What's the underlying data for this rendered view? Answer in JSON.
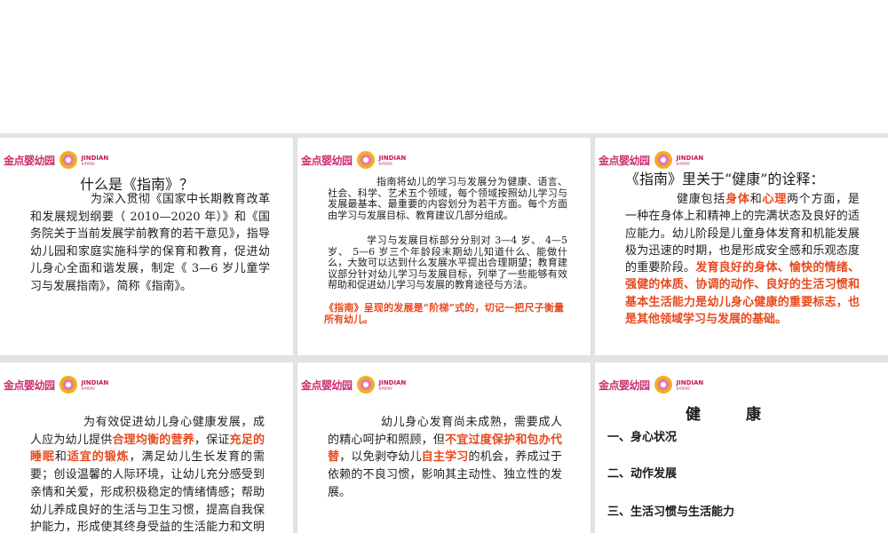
{
  "logo": {
    "text": "金点婴幼园",
    "brand": "JINDIAN",
    "brand_sub": "金点婴幼园",
    "icon": "jindian-emblem-icon",
    "colors": {
      "text": "#cc2f6f",
      "ring": "#f0b21c",
      "inner": "#e77aa8"
    }
  },
  "slides": [
    {
      "title": "什么是《指南》？",
      "paragraph": "为深入贯彻《国家中长期教育改革和发展规划纲要（ 2010—2020 年）》和《国务院关于当前发展学前教育的若干意见》，指导幼儿园和家庭实施科学的保育和教育，促进幼儿身心全面和谐发展，制定《 3—6 岁儿童学习与发展指南》，简称《指南》。"
    },
    {
      "para1": "指南将幼儿的学习与发展分为健康、语言、社会、科学、艺术五个领域，每个领域按照幼儿学习与发展最基本、最重要的内容划分为若干方面。每个方面由学习与发展目标、教育建议几部分组成。",
      "para2": "学习与发展目标部分分别对 3—4 岁、 4—5 岁、 5—6 岁三个年龄段末期幼儿知道什么、能做什么，大致可以达到什么发展水平提出合理期望；教育建议部分针对幼儿学习与发展目标，列举了一些能够有效帮助和促进幼儿学习与发展的教育途径与方法。",
      "note": "《指南》呈现的发展是“阶梯”式的，切记一把尺子衡量所有幼儿。"
    },
    {
      "title": "《指南》里关于“健康”的诠释：",
      "p1_a": "健康包括",
      "p1_hl1": "身体",
      "p1_b": "和",
      "p1_hl2": "心理",
      "p1_c": "两个方面，是一种在身体上和精神上的完满状态及良好的适应能力。幼儿阶段是儿童身体发育和机能发展极为迅速的时期，也是形成安全感和乐观态度的重要阶段。",
      "p1_hl3": "发育良好的身体、愉快的情绪、强健的体质、协调的动作、良好的生活习惯和基本生活能力是幼儿身心健康的重要标志，也是其他领域学习与发展的基础。"
    },
    {
      "p_a": "为有效促进幼儿身心健康发展，成人应为幼儿提供",
      "p_hl1": "合理均衡的营养",
      "p_b": "，保证",
      "p_hl2": "充足的睡眠",
      "p_c": "和",
      "p_hl3": "适宜的锻炼",
      "p_d": "，满足幼儿生长发育的需要；创设温馨的人际环境，让幼儿充分感受到亲情和关爱，形成积极稳定的情绪情感；帮助幼儿养成良好的生活与卫生习惯，提高自我保护能力，形成使其终身受益的生活能力和文明生活方式。"
    },
    {
      "p_a": "幼儿身心发育尚未成熟，需要成人的精心呵护和照顾，但",
      "p_hl1": "不宜过度保护和包办代替",
      "p_b": "，以免剥夺幼儿",
      "p_hl2": "自主学习",
      "p_c": "的机会，养成过于依赖的不良习惯，影响其主动性、独立性的发展。"
    },
    {
      "title": "健　　　康",
      "items": [
        "一、身心状况",
        "二、动作发展",
        "三、生活习惯与生活能力"
      ]
    }
  ]
}
